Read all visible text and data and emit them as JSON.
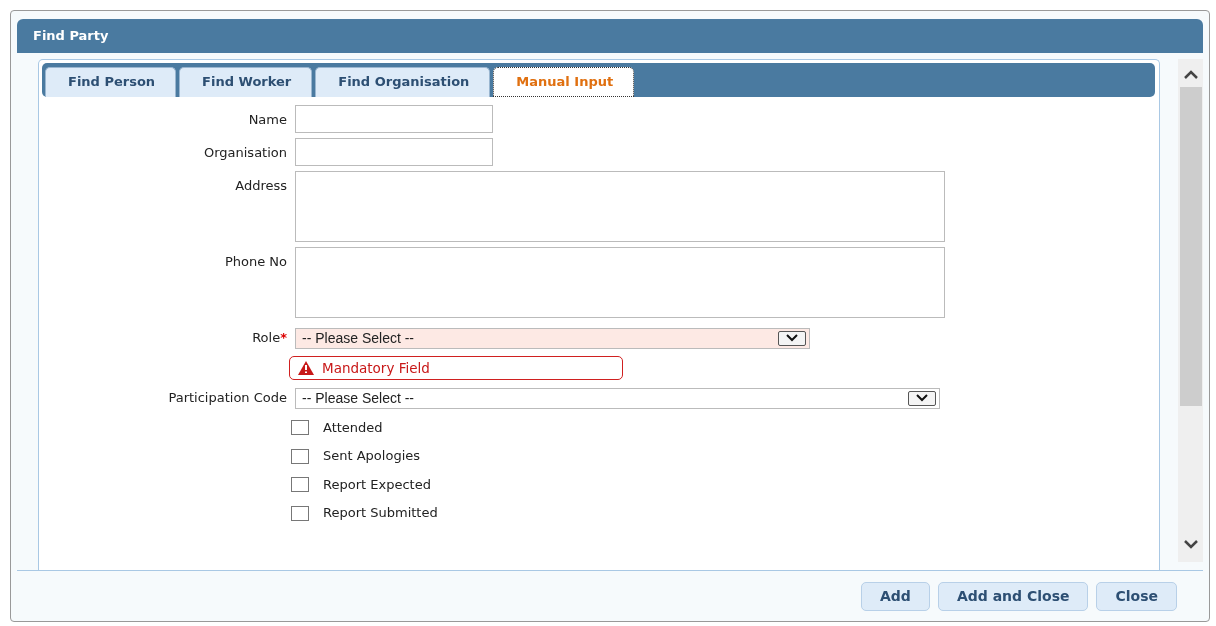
{
  "window": {
    "title": "Find Party"
  },
  "tabs": [
    {
      "label": "Find Person",
      "selected": false
    },
    {
      "label": "Find Worker",
      "selected": false
    },
    {
      "label": "Find Organisation",
      "selected": false
    },
    {
      "label": "Manual Input",
      "selected": true
    }
  ],
  "fields": [
    {
      "kind": "text",
      "label": "Name"
    },
    {
      "kind": "text",
      "label": "Organisation"
    },
    {
      "kind": "textarea",
      "label": "Address"
    },
    {
      "kind": "textarea",
      "label": "Phone No"
    },
    {
      "kind": "select",
      "label": "Role",
      "marker": "*",
      "value": "-- Please Select --",
      "error": "Mandatory Field"
    },
    {
      "kind": "select",
      "label": "Participation Code",
      "value": "-- Please Select --"
    }
  ],
  "checkboxes": [
    {
      "label": "Attended",
      "checked": false
    },
    {
      "label": "Sent Apologies",
      "checked": false
    },
    {
      "label": "Report Expected",
      "checked": false
    },
    {
      "label": "Report Submitted",
      "checked": false
    }
  ],
  "buttons": [
    "Add",
    "Add and Close",
    "Close"
  ]
}
